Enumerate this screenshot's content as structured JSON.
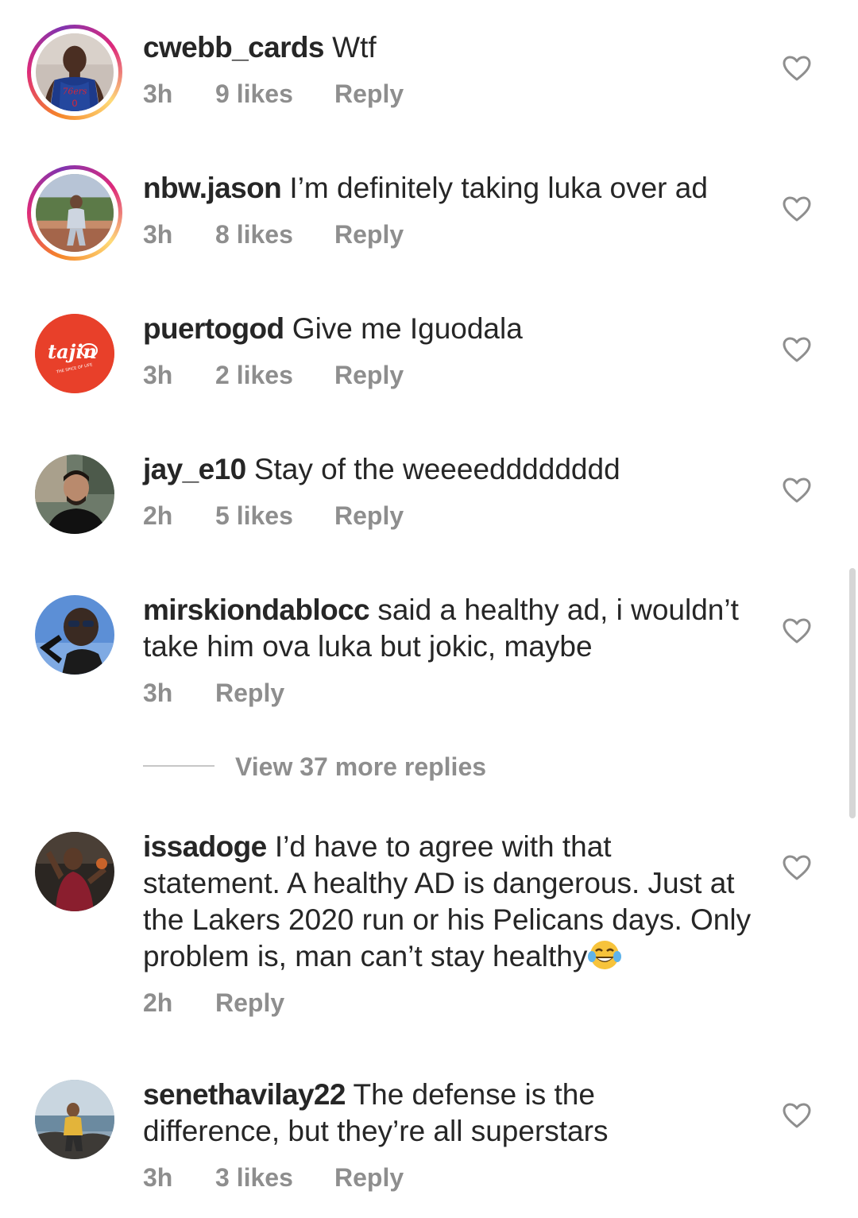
{
  "comments": [
    {
      "username": "cwebb_cards",
      "text": "Wtf",
      "time": "3h",
      "likes": "9 likes",
      "reply": "Reply",
      "avatar_icon": "jersey-player-avatar"
    },
    {
      "username": "nbw.jason",
      "text": "I’m definitely taking luka over ad",
      "time": "3h",
      "likes": "8 likes",
      "reply": "Reply",
      "avatar_icon": "outdoor-photo-avatar"
    },
    {
      "username": "puertogod",
      "text": "Give me Iguodala",
      "time": "3h",
      "likes": "2 likes",
      "reply": "Reply",
      "avatar_icon": "tajin-logo-avatar",
      "logo_text": "tajin",
      "logo_sub": "THE SPICE OF LIFE"
    },
    {
      "username": "jay_e10",
      "text": "Stay of the weeeedddddddd",
      "time": "2h",
      "likes": "5 likes",
      "reply": "Reply",
      "avatar_icon": "man-portrait-avatar"
    },
    {
      "username": "mirskiondablocc",
      "text": "said a healthy ad, i wouldn’t take him ova luka but jokic, maybe",
      "time": "3h",
      "reply": "Reply",
      "avatar_icon": "sky-selfie-avatar"
    },
    {
      "username": "issadoge",
      "text": "I’d have to agree with that statement. A healthy AD is dangerous. Just at the Lakers 2020 run or his Pelicans days. Only problem is, man can’t stay healthy",
      "emoji": "😂",
      "time": "2h",
      "reply": "Reply",
      "avatar_icon": "basketball-player-avatar"
    },
    {
      "username": "senethavilay22",
      "text": "The defense is the difference, but they’re all superstars",
      "time": "3h",
      "likes": "3 likes",
      "reply": "Reply",
      "avatar_icon": "beach-photo-avatar"
    }
  ],
  "view_more_replies": "View 37 more replies",
  "colors": {
    "text": "#262626",
    "secondary": "#8e8e8e",
    "story_ring": "#dd2a7b",
    "tajin_red": "#e8402a"
  }
}
